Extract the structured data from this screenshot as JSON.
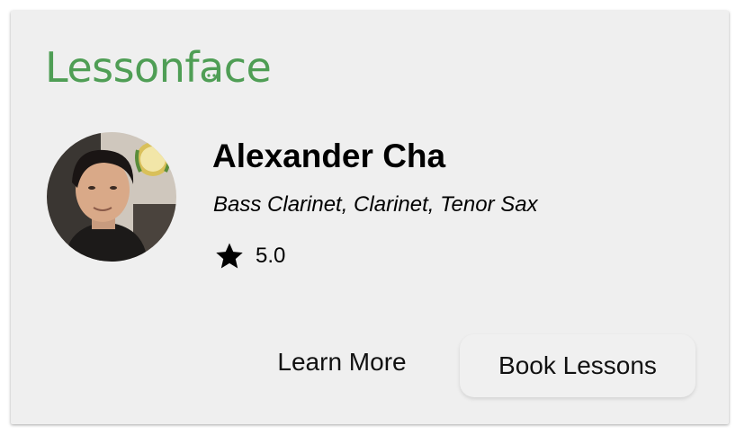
{
  "brand": {
    "logo_prefix": "Lessonf",
    "logo_face_letter": "a",
    "logo_suffix": "ce",
    "logo_color": "#4f9e55"
  },
  "teacher": {
    "name": "Alexander Cha",
    "instruments": "Bass Clarinet, Clarinet, Tenor Sax",
    "rating": "5.0",
    "rating_icon": "star-icon",
    "avatar": "teacher-photo"
  },
  "actions": {
    "learn_more_label": "Learn More",
    "book_lessons_label": "Book Lessons"
  },
  "colors": {
    "card_background": "#efefef",
    "text": "#000000"
  }
}
